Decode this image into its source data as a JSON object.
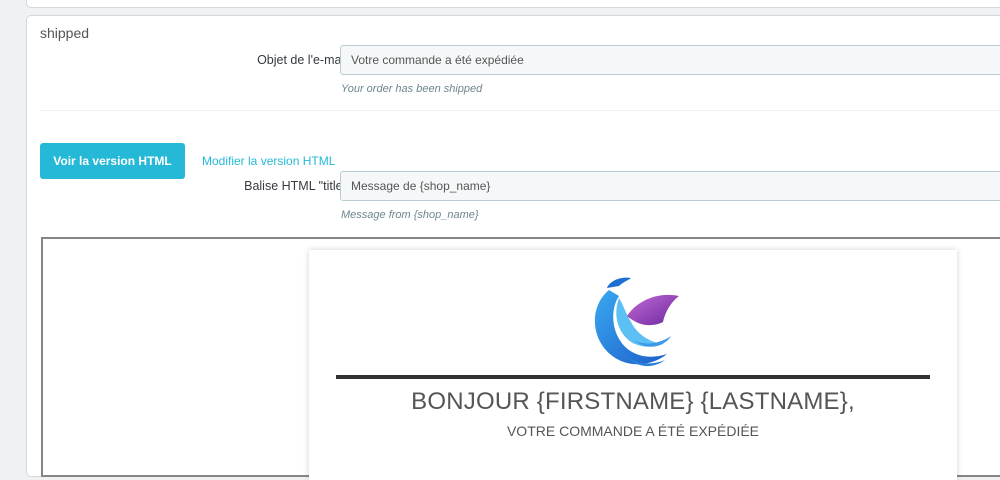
{
  "section": {
    "title": "shipped"
  },
  "subject": {
    "label": "Objet de l'e-mail",
    "value": "Votre commande a été expédiée",
    "help": "Your order has been shipped"
  },
  "tabs": {
    "view_html": "Voir la version HTML",
    "edit_html": "Modifier la version HTML"
  },
  "title_tag": {
    "label": "Balise HTML \"title\"",
    "value": "Message de {shop_name}",
    "help": "Message from {shop_name}"
  },
  "preview": {
    "heading": "BONJOUR {FIRSTNAME} {LASTNAME},",
    "subheading": "VOTRE COMMANDE A ÉTÉ EXPÉDIÉE",
    "logo_icon": "phoenix-bird-logo"
  },
  "colors": {
    "accent": "#25b9d7",
    "logo_blue": "#2f8fe0",
    "logo_purple": "#8e3fb5"
  }
}
